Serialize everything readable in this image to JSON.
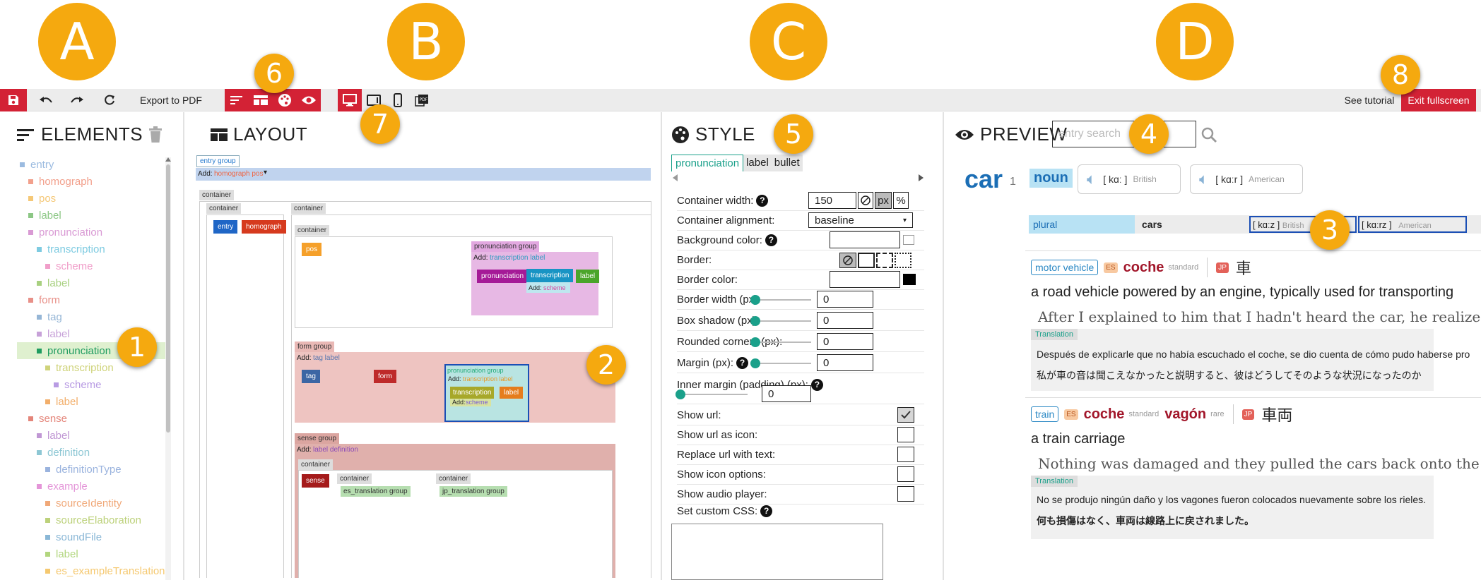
{
  "highlights": {
    "A": "A",
    "B": "B",
    "C": "C",
    "D": "D",
    "n1": "1",
    "n2": "2",
    "n3": "3",
    "n4": "4",
    "n5": "5",
    "n6": "6",
    "n7": "7",
    "n8": "8"
  },
  "toolbar": {
    "export_label": "Export to PDF",
    "tutorial_label": "See tutorial",
    "exit_label": "Exit fullscreen"
  },
  "elements": {
    "title": "ELEMENTS",
    "items": [
      {
        "label": "entry",
        "color": "#9bbbe0",
        "indent": 0
      },
      {
        "label": "homograph",
        "color": "#f2a08c",
        "indent": 1
      },
      {
        "label": "pos",
        "color": "#f5c877",
        "indent": 1
      },
      {
        "label": "label",
        "color": "#8cc785",
        "indent": 1
      },
      {
        "label": "pronunciation",
        "color": "#d99ad4",
        "indent": 1
      },
      {
        "label": "transcription",
        "color": "#7ecbe1",
        "indent": 2
      },
      {
        "label": "scheme",
        "color": "#f09ec9",
        "indent": 3
      },
      {
        "label": "label",
        "color": "#a8d080",
        "indent": 2
      },
      {
        "label": "form",
        "color": "#e89088",
        "indent": 1
      },
      {
        "label": "tag",
        "color": "#96b6d6",
        "indent": 2
      },
      {
        "label": "label",
        "color": "#c7a1d8",
        "indent": 2
      },
      {
        "label": "pronunciation",
        "color": "#1f9c60",
        "indent": 2,
        "selected": true
      },
      {
        "label": "transcription",
        "color": "#cfd37a",
        "indent": 3
      },
      {
        "label": "scheme",
        "color": "#b89be3",
        "indent": 4
      },
      {
        "label": "label",
        "color": "#f2ae6a",
        "indent": 3
      },
      {
        "label": "sense",
        "color": "#e4857a",
        "indent": 1
      },
      {
        "label": "label",
        "color": "#c097d4",
        "indent": 2
      },
      {
        "label": "definition",
        "color": "#8dc7d4",
        "indent": 2
      },
      {
        "label": "definitionType",
        "color": "#9ab3de",
        "indent": 3
      },
      {
        "label": "example",
        "color": "#e495d8",
        "indent": 2
      },
      {
        "label": "sourceIdentity",
        "color": "#f0a878",
        "indent": 3
      },
      {
        "label": "sourceElaboration",
        "color": "#bcd17a",
        "indent": 3
      },
      {
        "label": "soundFile",
        "color": "#8ab7d6",
        "indent": 3
      },
      {
        "label": "label",
        "color": "#b2d67e",
        "indent": 3
      },
      {
        "label": "es_exampleTranslation",
        "color": "#f5c86f",
        "indent": 3
      }
    ]
  },
  "layout": {
    "title": "LAYOUT",
    "entry_group": "entry group",
    "add": "Add:",
    "homograph_pos": "homograph pos",
    "container": "container",
    "entry": "entry",
    "homograph": "homograph",
    "pos": "pos",
    "pron_group": "pronunciation group",
    "transcription_label": "transcription label",
    "pronunciation": "pronunciation",
    "transcription": "transcription",
    "label": "label",
    "scheme": "scheme",
    "form_group": "form group",
    "tag_label": "tag label",
    "tag": "tag",
    "form": "form",
    "sense_group": "sense group",
    "label_definition": "label definition",
    "sense": "sense",
    "es_group": "es_translation group",
    "jp_group": "jp_translation group"
  },
  "style": {
    "title": "STYLE",
    "tabs": [
      "pronunciation",
      "label",
      "bullet"
    ],
    "rows": {
      "container_width": "Container width:",
      "alignment": "Container alignment:",
      "bg": "Background color:",
      "border": "Border:",
      "border_color": "Border color:",
      "border_width": "Border width (px):",
      "shadow": "Box shadow (px):",
      "rounded": "Rounded corners (px):",
      "margin": "Margin (px):",
      "padding": "Inner margin (padding) (px):",
      "show_url": "Show url:",
      "url_icon": "Show url as icon:",
      "replace_url": "Replace url with text:",
      "icon_options": "Show icon options:",
      "audio": "Show audio player:",
      "css": "Set custom CSS:"
    },
    "values": {
      "width": "150",
      "alignment": "baseline",
      "border_width": "0",
      "shadow": "0",
      "rounded": "0",
      "margin": "0",
      "padding": "0",
      "px": "px",
      "pct": "%"
    }
  },
  "preview": {
    "title": "PREVIEW",
    "search_placeholder": "entry search",
    "headword": "car",
    "homograph": "1",
    "pos": "noun",
    "pron1": "[ kɑː ]",
    "pron1_label": "British",
    "pron2": "[ kɑːr ]",
    "pron2_label": "American",
    "plural_label": "plural",
    "plural_form": "cars",
    "pl_pron1": "[ kɑːz ]",
    "pl_pron1_label": "British",
    "pl_pron2": "[ kɑːrz ]",
    "pl_pron2_label": "American",
    "s1_tag": "motor vehicle",
    "es": "ES",
    "s1_es": "coche",
    "standard": "standard",
    "jp": "JP",
    "s1_jp": "車",
    "s1_def": "a road vehicle powered by an engine, typically used for transporting",
    "s1_ex": "After I explained to him that I hadn't heard the car, he realized how",
    "translation": "Translation",
    "s1_tr_es": "Después de explicarle que no había escuchado el coche, se dio cuenta de cómo pudo haberse pro",
    "s1_tr_jp": "私が車の音は聞こえなかったと説明すると、彼はどうしてそのような状況になったのか",
    "s2_tag": "train",
    "s2_es": "coche",
    "s2_es2": "vagón",
    "rare": "rare",
    "s2_jp": "車両",
    "s2_def": "a train carriage",
    "s2_ex": "Nothing was damaged and they pulled the cars back onto the rails.",
    "s2_tr_es": "No se produjo ningún daño y los vagones fueron colocados nuevamente sobre los rieles.",
    "s2_tr_jp": "何も損傷はなく、車両は線路上に戻されました。"
  },
  "colors": {
    "red": "#d32235",
    "accent": "#f5a90f",
    "teal": "#1aa08a",
    "blue": "#1b6eb5"
  }
}
